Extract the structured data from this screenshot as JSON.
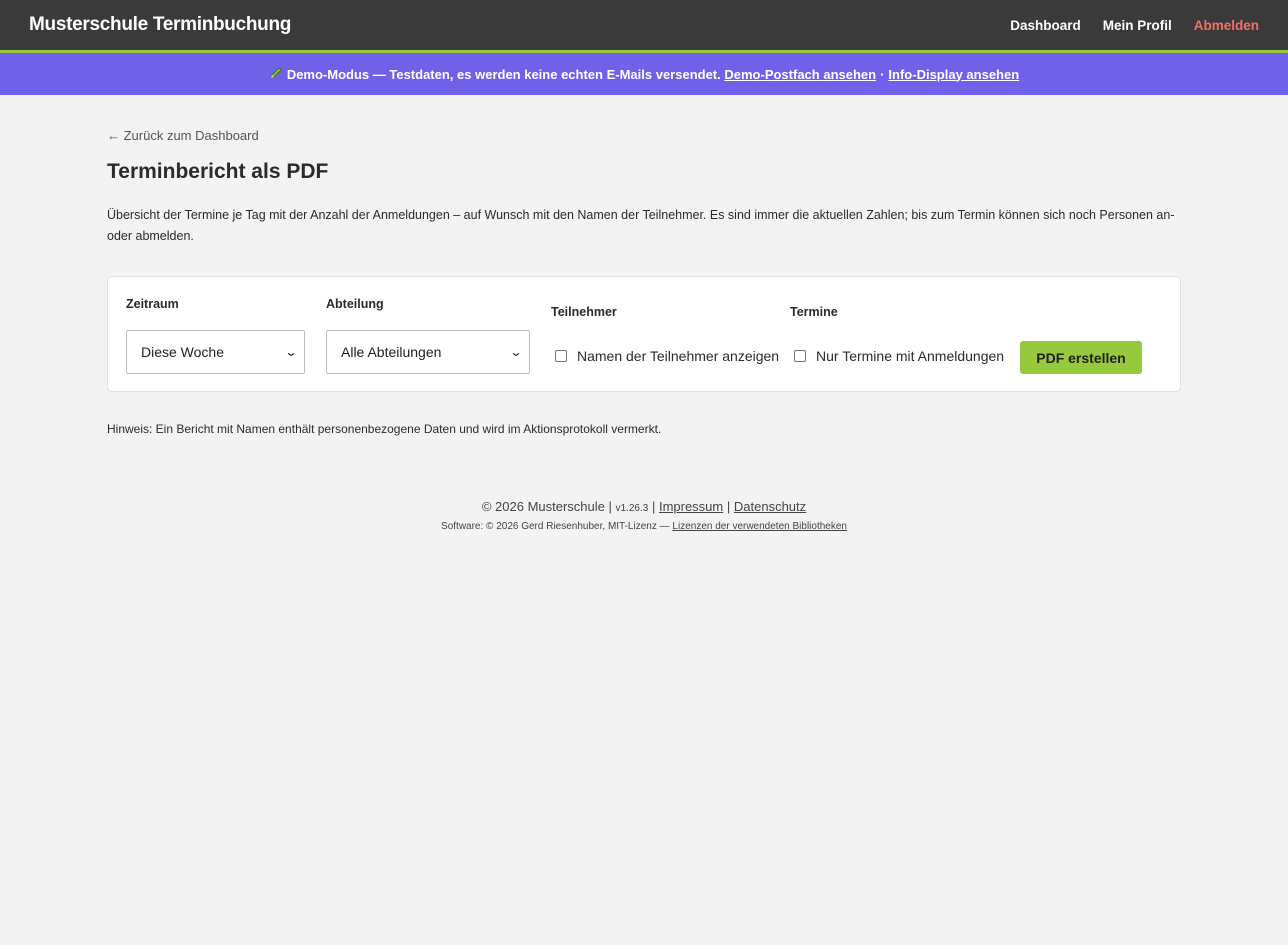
{
  "header": {
    "brand": "Musterschule Terminbuchung",
    "nav": {
      "dashboard": "Dashboard",
      "profile": "Mein Profil",
      "logout": "Abmelden"
    }
  },
  "demo_banner": {
    "icon": "pencil-icon",
    "text": "Demo-Modus — Testdaten, es werden keine echten E-Mails versendet.",
    "link1": "Demo-Postfach ansehen",
    "separator": "·",
    "link2": "Info-Display ansehen"
  },
  "page": {
    "back_link": "← Zurück zum Dashboard",
    "title": "Terminbericht als PDF",
    "description": "Übersicht der Termine je Tag mit der Anzahl der Anmeldungen – auf Wunsch mit den Namen der Teilnehmer. Es sind immer die aktuellen Zahlen; bis zum Termin können sich noch Personen an- oder abmelden."
  },
  "form": {
    "period_label": "Zeitraum",
    "period_value": "Diese Woche",
    "department_label": "Abteilung",
    "department_value": "Alle Abteilungen",
    "participants_label": "Teilnehmer",
    "participants_checkbox": "Namen der Teilnehmer anzeigen",
    "appointments_label": "Termine",
    "appointments_checkbox": "Nur Termine mit Anmeldungen",
    "submit": "PDF erstellen"
  },
  "note": "Hinweis: Ein Bericht mit Namen enthält personenbezogene Daten und wird im Aktionsprotokoll vermerkt.",
  "footer": {
    "copyright": "© 2026 Musterschule |",
    "version": "v1.26.3",
    "pipe1": "|",
    "impressum": "Impressum",
    "pipe2": "|",
    "privacy": "Datenschutz",
    "software": "Software: © 2026 Gerd Riesenhuber, MIT-Lizenz —",
    "licenses": "Lizenzen der verwendeten Bibliotheken"
  }
}
